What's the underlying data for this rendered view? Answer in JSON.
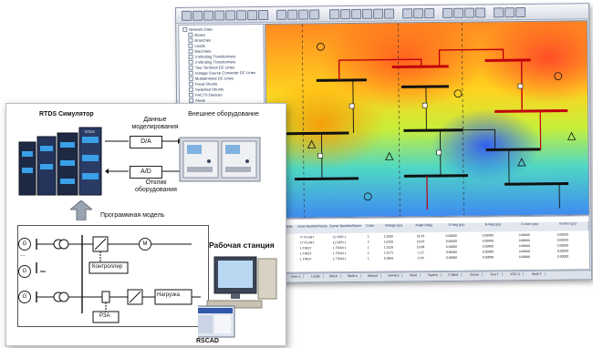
{
  "software": {
    "tree_items": [
      "Network Data",
      "Buses",
      "Branches",
      "Loads",
      "Machines",
      "2-Winding Transformers",
      "3-Winding Transformers",
      "Two-Terminal DC Lines",
      "Voltage Source Converter DC Lines",
      "Multiterminal DC Lines",
      "Fixed Shunts",
      "Switched Shunts",
      "FACTS Devices",
      "Areas",
      "Owners",
      "Zones"
    ],
    "table_title": "Diagram Files\\RTDS\\1-BASES\\bus.sav - Network data - Buses",
    "table_headers": [
      "Bus Number",
      "Bus Name",
      "Base kV",
      "Area Number/Name",
      "Zone Number/Name",
      "Owner Number/Name",
      "Code",
      "Voltage (pu)",
      "Angle (deg)",
      "G-Neg (pu)",
      "B-Neg (pu)",
      "G-Zero (pu)",
      "B-Zero (pu)"
    ],
    "table_rows": [
      [
        "101",
        "NUC-A",
        "21.6",
        "1 FLAPCO",
        "77 PLANT",
        "11 GEN 1",
        "2",
        "1.0200",
        "18.33",
        "0.00000",
        "0.00000",
        "0.00000",
        "0.00000"
      ],
      [
        "102",
        "NUC-B",
        "21.6",
        "1 FLAPCO",
        "77 PLANT",
        "11 GEN 1",
        "2",
        "1.0200",
        "18.33",
        "0.00000",
        "0.00000",
        "0.00000",
        "0.00000"
      ],
      [
        "151",
        "NUCPANT",
        "500.0",
        "1 FLAPCO",
        "1 FIRST",
        "1 TRAN 1",
        "1",
        "1.0118",
        "10.88",
        "0.00000",
        "0.00000",
        "0.00000",
        "0.00000"
      ],
      [
        "152",
        "MID500",
        "500.0",
        "1 FLAPCO",
        "1 FIRST",
        "1 TRAN 1",
        "1",
        "1.0171",
        "-1.12",
        "0.00000",
        "0.00000",
        "0.00000",
        "0.00000"
      ],
      [
        "153",
        "MID230",
        "230.0",
        "1 FLAPCO",
        "1 FIRST",
        "1 TRAN 1",
        "1",
        "0.9856",
        "-3.34",
        "0.00000",
        "0.00000",
        "0.00000",
        "0.00000"
      ]
    ],
    "status_tabs": [
      "Buses",
      "Branch",
      "FACT",
      "Fixed",
      "Impedance",
      "Inter-a",
      "Loads",
      "Mach",
      "Multi-s",
      "Mutual",
      "Owners",
      "Plant",
      "Switch",
      "2 Wind",
      "Zones",
      "Two T",
      "VSC D",
      "Multi T"
    ]
  },
  "diagram": {
    "rtds_title": "RTDS Симулятор",
    "model_data_label": "Данные моделирования",
    "da_label": "D/A",
    "ad_label": "A/D",
    "external_eq_label": "Внешнее оборудование",
    "response_label": "Отклик оборудования",
    "program_model_label": "Программная модель",
    "workstation_label": "Рабочая станция",
    "rscad_label": "RSCAD",
    "g_symbol": "G",
    "m_symbol": "M",
    "controller_label": "Контроллер",
    "load_label": "Нагрузка",
    "rza_label": "РЗА",
    "dots": "...",
    "brand_label": "RTDS"
  }
}
